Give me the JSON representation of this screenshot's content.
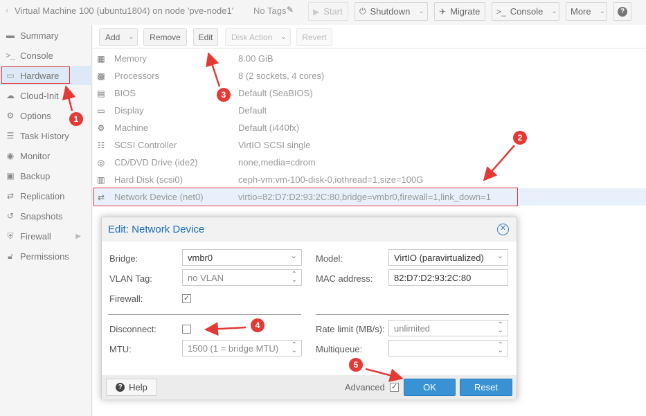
{
  "topbar": {
    "title": "Virtual Machine 100 (ubuntu1804) on node 'pve-node1'",
    "tags": "No Tags",
    "start": "Start",
    "shutdown": "Shutdown",
    "migrate": "Migrate",
    "console": "Console",
    "more": "More",
    "help": "?"
  },
  "sidebar": {
    "items": [
      {
        "label": "Summary",
        "icon": "book-icon"
      },
      {
        "label": "Console",
        "icon": "terminal-icon"
      },
      {
        "label": "Hardware",
        "icon": "monitor-icon"
      },
      {
        "label": "Cloud-Init",
        "icon": "cloud-icon"
      },
      {
        "label": "Options",
        "icon": "gear-icon"
      },
      {
        "label": "Task History",
        "icon": "list-icon"
      },
      {
        "label": "Monitor",
        "icon": "eye-icon"
      },
      {
        "label": "Backup",
        "icon": "floppy-icon"
      },
      {
        "label": "Replication",
        "icon": "retweet-icon"
      },
      {
        "label": "Snapshots",
        "icon": "history-icon"
      },
      {
        "label": "Firewall",
        "icon": "shield-icon"
      },
      {
        "label": "Permissions",
        "icon": "unlock-icon"
      }
    ]
  },
  "hw_toolbar": {
    "add": "Add",
    "remove": "Remove",
    "edit": "Edit",
    "disk_action": "Disk Action",
    "revert": "Revert"
  },
  "hardware": [
    {
      "name": "Memory",
      "value": "8.00 GiB",
      "icon": "memory-icon"
    },
    {
      "name": "Processors",
      "value": "8 (2 sockets, 4 cores)",
      "icon": "cpu-icon"
    },
    {
      "name": "BIOS",
      "value": "Default (SeaBIOS)",
      "icon": "chip-icon"
    },
    {
      "name": "Display",
      "value": "Default",
      "icon": "desktop-icon"
    },
    {
      "name": "Machine",
      "value": "Default (i440fx)",
      "icon": "cogs-icon"
    },
    {
      "name": "SCSI Controller",
      "value": "VirtIO SCSI single",
      "icon": "database-icon"
    },
    {
      "name": "CD/DVD Drive (ide2)",
      "value": "none,media=cdrom",
      "icon": "cdrom-icon"
    },
    {
      "name": "Hard Disk (scsi0)",
      "value": "ceph-vm:vm-100-disk-0,iothread=1,size=100G",
      "icon": "harddisk-icon"
    },
    {
      "name": "Network Device (net0)",
      "value": "virtio=82:D7:D2:93:2C:80,bridge=vmbr0,firewall=1,link_down=1",
      "icon": "exchange-icon"
    }
  ],
  "dialog": {
    "title": "Edit: Network Device",
    "bridge_label": "Bridge:",
    "bridge_value": "vmbr0",
    "vlan_label": "VLAN Tag:",
    "vlan_value": "no VLAN",
    "firewall_label": "Firewall:",
    "firewall_checked": true,
    "model_label": "Model:",
    "model_value": "VirtIO (paravirtualized)",
    "mac_label": "MAC address:",
    "mac_value": "82:D7:D2:93:2C:80",
    "disconnect_label": "Disconnect:",
    "disconnect_checked": false,
    "mtu_label": "MTU:",
    "mtu_value": "1500 (1 = bridge MTU)",
    "rate_label": "Rate limit (MB/s):",
    "rate_value": "unlimited",
    "multiqueue_label": "Multiqueue:",
    "multiqueue_value": "",
    "help": "Help",
    "advanced": "Advanced",
    "advanced_checked": true,
    "ok": "OK",
    "reset": "Reset"
  },
  "annotations": [
    "1",
    "2",
    "3",
    "4",
    "5"
  ],
  "colors": {
    "annotation": "#e53935",
    "accent": "#3892d4",
    "title_blue": "#1c6db8",
    "selected_row": "#e8f1fb"
  }
}
